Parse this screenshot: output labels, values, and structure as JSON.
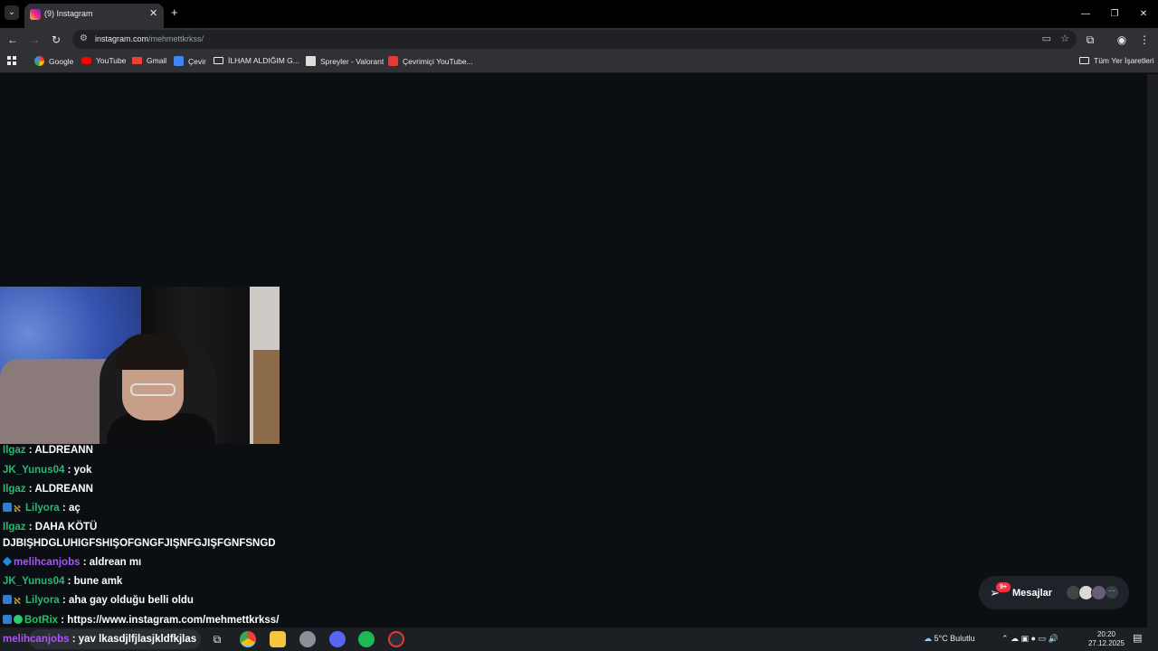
{
  "browser": {
    "tab_title": "(9) Instagram",
    "url_host": "instagram.com",
    "url_path": "/mehmettkrkss/",
    "bookmarks": [
      {
        "label": "Google"
      },
      {
        "label": "YouTube"
      },
      {
        "label": "Gmail"
      },
      {
        "label": "Çevir"
      },
      {
        "label": "İLHAM ALDIĞIM G..."
      },
      {
        "label": "Spreyler - Valorant"
      },
      {
        "label": "Çevrimiçi YouTube..."
      }
    ],
    "all_bookmarks": "Tüm Yer İşaretleri"
  },
  "chat": [
    {
      "user": "Ilgaz",
      "color": "#2bb673",
      "text": "ALDREANN",
      "badges": []
    },
    {
      "user": "JK_Yunus04",
      "color": "#2bb673",
      "text": "yok",
      "badges": []
    },
    {
      "user": "Ilgaz",
      "color": "#2bb673",
      "text": "ALDREANN",
      "badges": []
    },
    {
      "user": "Lilyora",
      "color": "#2bb673",
      "text": "aç",
      "badges": [
        "blue",
        "gold"
      ]
    },
    {
      "user": "Ilgaz",
      "color": "#2bb673",
      "text": "DAHA KÖTÜ",
      "badges": []
    },
    {
      "user": "",
      "color": "#ffffff",
      "text": "DJBIŞHDGLUHIGFSHIŞOFGNGFJIŞNFGJIŞFGNFSNGD",
      "badges": []
    },
    {
      "user": "melihcanjobs",
      "color": "#a855f7",
      "text": "aldrean mı",
      "badges": [
        "cube"
      ]
    },
    {
      "user": "JK_Yunus04",
      "color": "#2bb673",
      "text": "bune amk",
      "badges": []
    },
    {
      "user": "Lilyora",
      "color": "#2bb673",
      "text": "aha gay olduğu belli oldu",
      "badges": [
        "blue",
        "gold"
      ]
    },
    {
      "user": "BotRix",
      "color": "#22c55e",
      "text": "https://www.instagram.com/mehmettkrkss/",
      "badges": [
        "blue",
        "check"
      ]
    }
  ],
  "taskbar_chat": {
    "user": "melihcanjobs",
    "text": "yav lkasdjlfjlasjkldfkjlas"
  },
  "messages": {
    "label": "Mesajlar",
    "badge": "9+"
  },
  "tray": {
    "weather_temp": "5°C",
    "weather_desc": "Bulutlu",
    "time": "20:20",
    "date": "27.12.2025"
  },
  "colors": {
    "page_bg": "#0b0f14",
    "chrome_bg": "#303134",
    "accent_red": "#ff3040"
  }
}
